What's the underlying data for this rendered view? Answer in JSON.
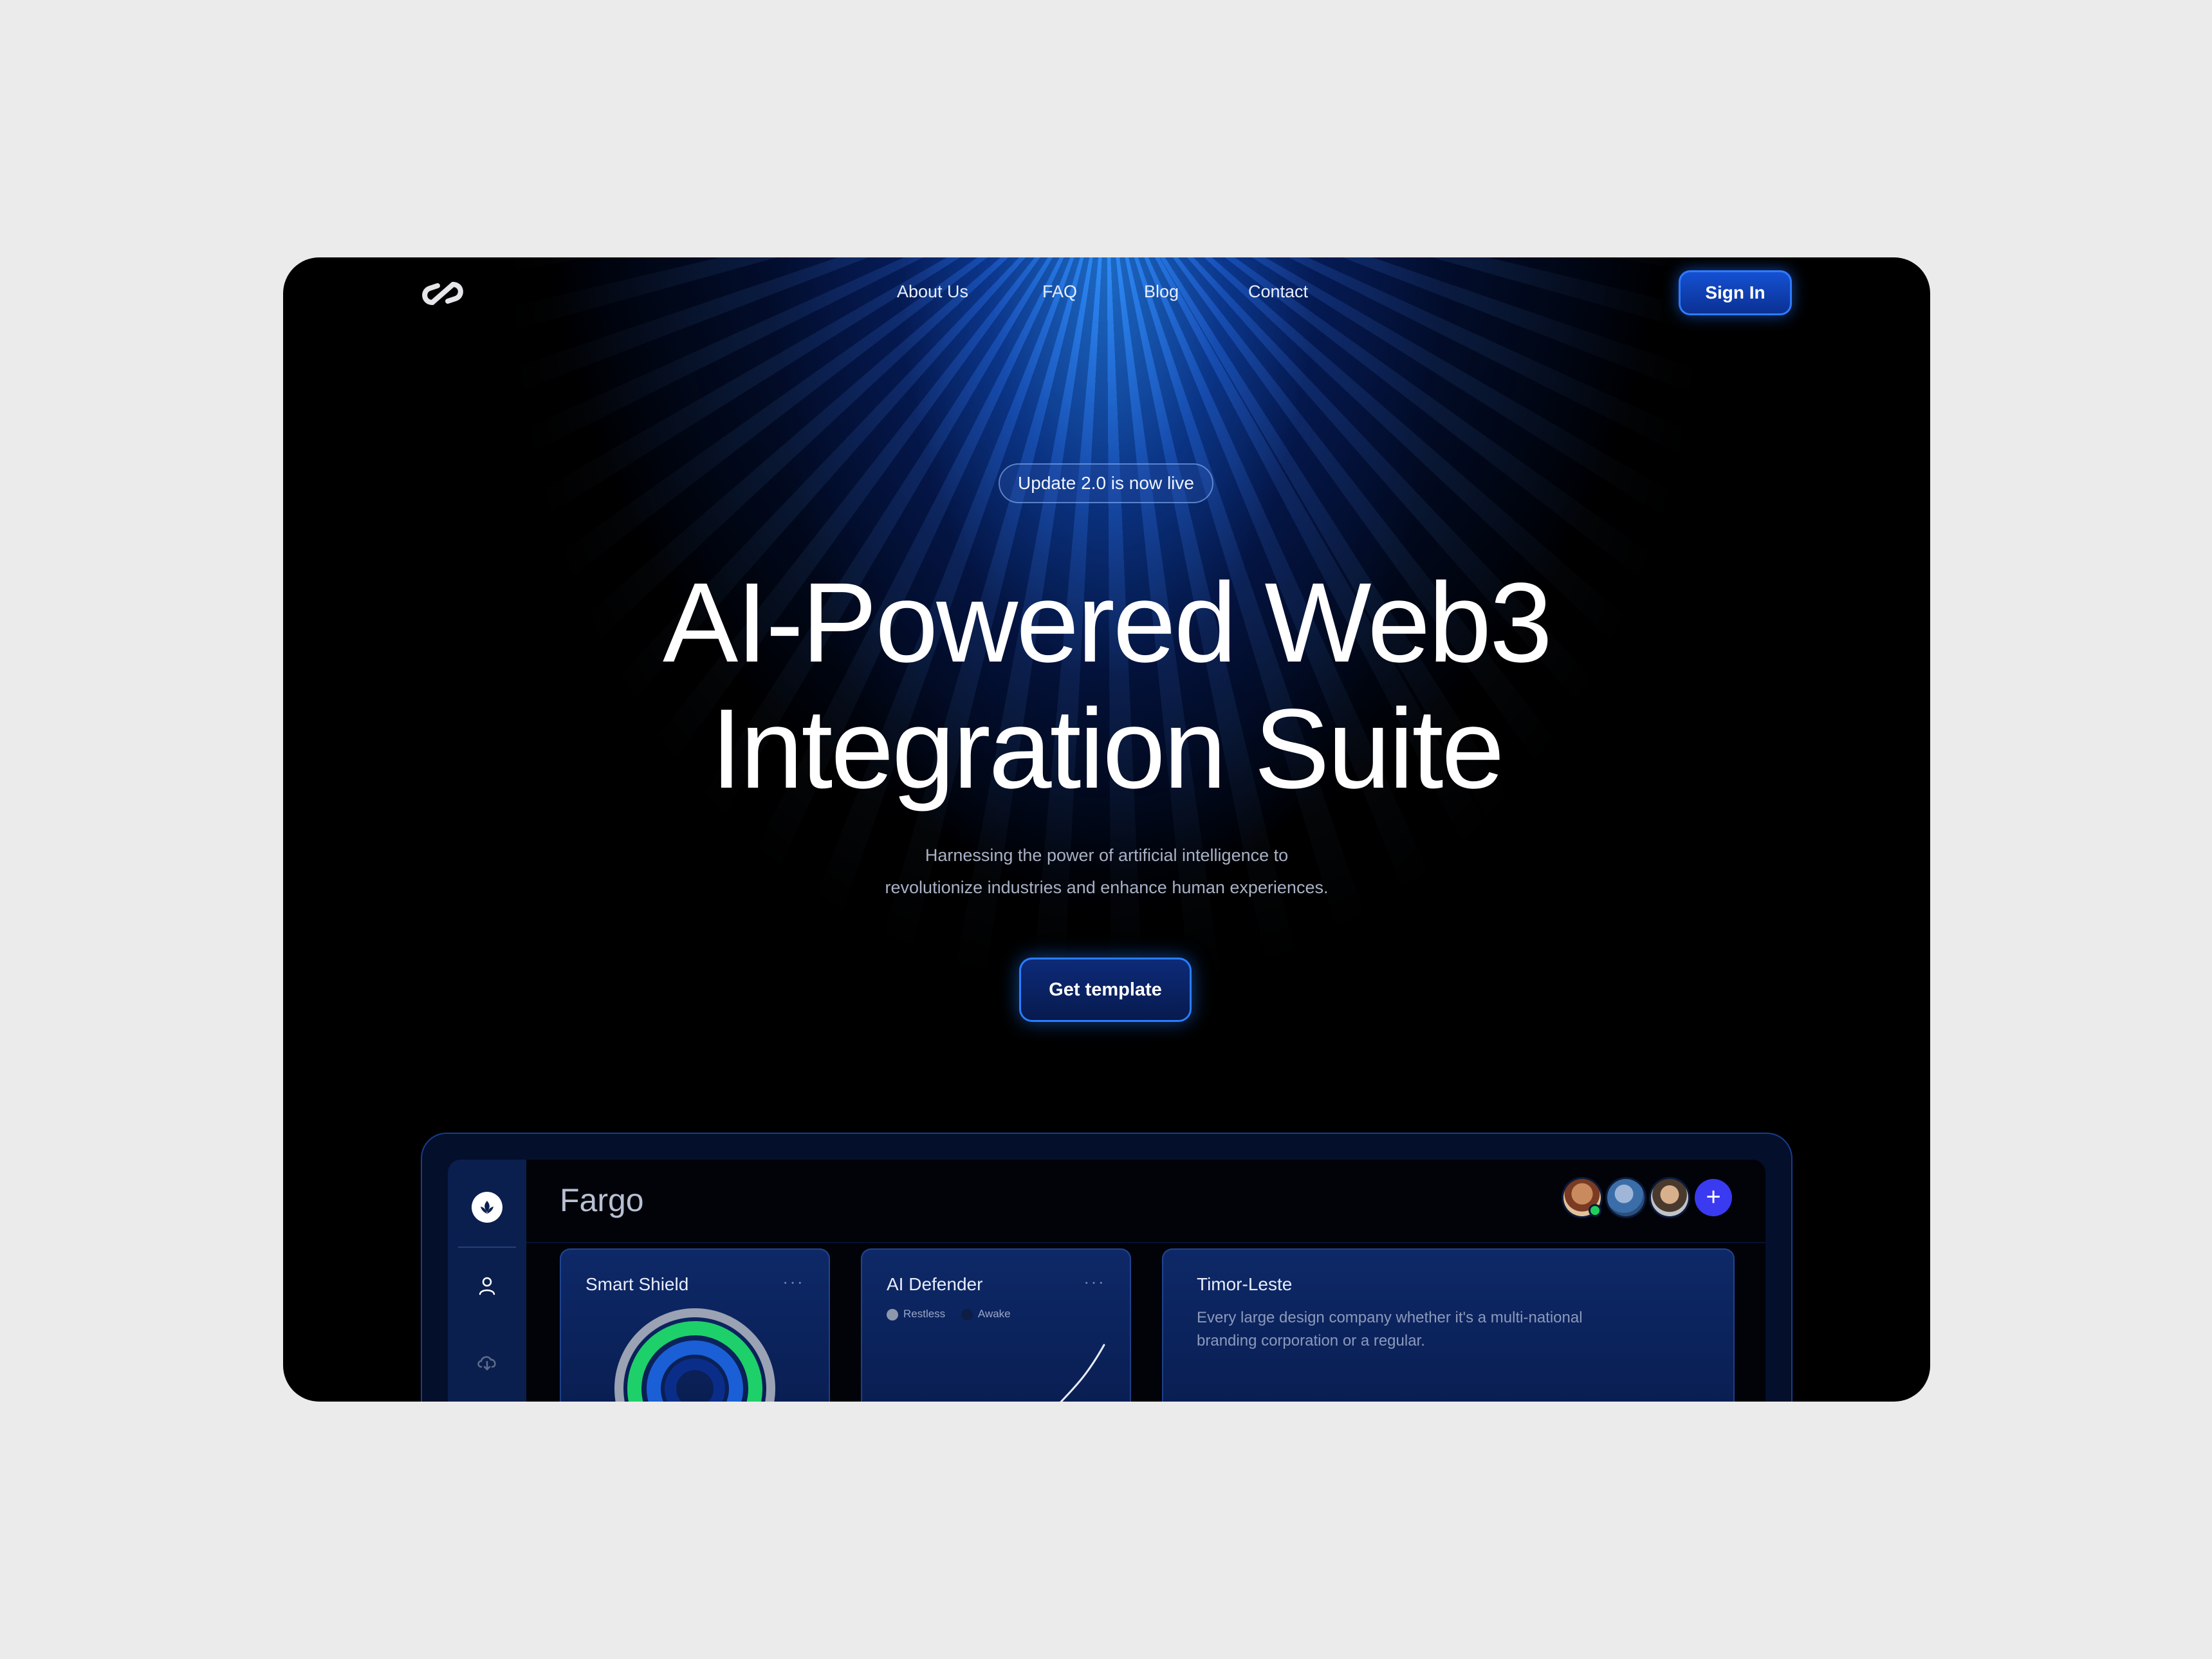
{
  "nav": {
    "items": [
      "About Us",
      "FAQ",
      "Blog",
      "Contact"
    ],
    "sign_in": "Sign In"
  },
  "hero": {
    "badge": "Update 2.0 is now live",
    "headline_line1": "AI-Powered Web3",
    "headline_line2": "Integration Suite",
    "subtext_line1": "Harnessing the power of artificial intelligence to",
    "subtext_line2": "revolutionize industries and enhance human experiences.",
    "cta": "Get template"
  },
  "dashboard": {
    "title": "Fargo",
    "add_symbol": "+",
    "cards": [
      {
        "title": "Smart Shield",
        "more": "···"
      },
      {
        "title": "AI Defender",
        "more": "···",
        "legend": [
          "Restless",
          "Awake"
        ]
      },
      {
        "title": "Timor-Leste",
        "text_line1": "Every large design company whether it's a multi-national",
        "text_line2": "branding corporation or a regular."
      }
    ],
    "sidebar_icons": [
      "leaf-icon",
      "user-icon",
      "cloud-icon"
    ]
  },
  "colors": {
    "page_bg": "#ebebeb",
    "frame_bg": "#000000",
    "accent_blue": "#1552d6",
    "glow_blue": "#2a7dff",
    "add_button": "#3a3af0",
    "online": "#1fcf5a"
  }
}
